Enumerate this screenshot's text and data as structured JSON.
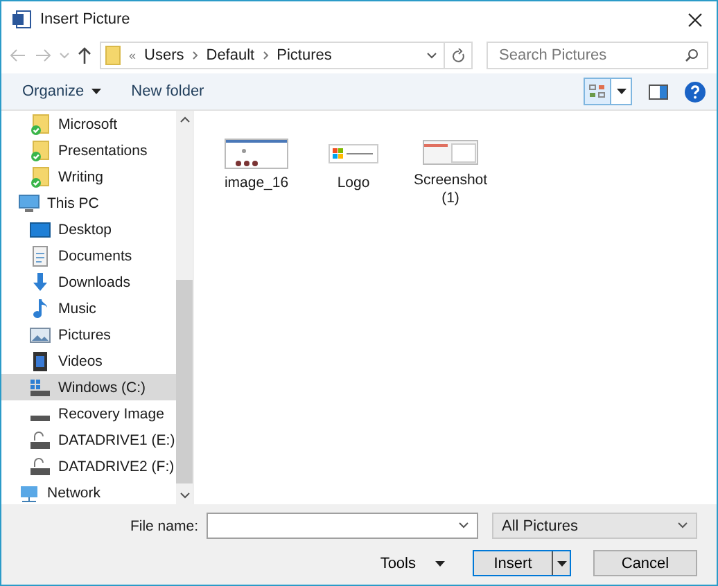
{
  "window": {
    "title": "Insert Picture"
  },
  "address": {
    "path": [
      {
        "label": "Users"
      },
      {
        "label": "Default"
      },
      {
        "label": "Pictures"
      }
    ],
    "overflow": "«"
  },
  "search": {
    "placeholder": "Search Pictures"
  },
  "toolbar": {
    "organize": "Organize",
    "new_folder": "New folder"
  },
  "sidebar": {
    "items": [
      {
        "label": "Microsoft",
        "kind": "synced-folder",
        "selected": false
      },
      {
        "label": "Presentations",
        "kind": "synced-folder",
        "selected": false
      },
      {
        "label": "Writing",
        "kind": "synced-folder",
        "selected": false
      },
      {
        "label": "This PC",
        "kind": "pc",
        "selected": false,
        "children": [
          {
            "label": "Desktop",
            "kind": "desktop",
            "selected": false
          },
          {
            "label": "Documents",
            "kind": "documents",
            "selected": false
          },
          {
            "label": "Downloads",
            "kind": "downloads",
            "selected": false
          },
          {
            "label": "Music",
            "kind": "music",
            "selected": false
          },
          {
            "label": "Pictures",
            "kind": "pictures",
            "selected": false
          },
          {
            "label": "Videos",
            "kind": "videos",
            "selected": false
          },
          {
            "label": "Windows (C:)",
            "kind": "system-drive",
            "selected": true
          },
          {
            "label": "Recovery Image",
            "kind": "drive",
            "selected": false
          },
          {
            "label": "DATADRIVE1 (E:)",
            "kind": "locked-drive",
            "selected": false
          },
          {
            "label": "DATADRIVE2 (F:)",
            "kind": "locked-drive",
            "selected": false
          }
        ]
      },
      {
        "label": "Network",
        "kind": "network",
        "selected": false
      }
    ]
  },
  "files": [
    {
      "name": "image_16",
      "kind": "diagram"
    },
    {
      "name": "Logo",
      "kind": "logo"
    },
    {
      "name": "Screenshot (1)",
      "kind": "screenshot"
    }
  ],
  "footer": {
    "file_name_label": "File name:",
    "filter": "All Pictures",
    "tools": "Tools",
    "insert": "Insert",
    "cancel": "Cancel"
  }
}
